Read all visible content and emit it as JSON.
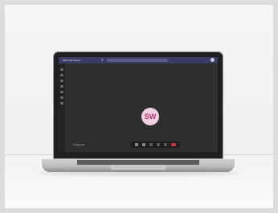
{
  "window": {
    "title": "Microsoft Teams"
  },
  "call": {
    "participant_initials": "SW",
    "selfview_label": "Contoso Ltd."
  },
  "colors": {
    "titlebar": "#3b3b63",
    "avatar_bg": "#f1cfe1",
    "avatar_text": "#b7366f",
    "leave_button": "#c4314b"
  },
  "icons": {
    "rail": [
      "activity-icon",
      "chat-icon",
      "teams-icon",
      "calendar-icon",
      "calls-icon",
      "files-icon",
      "apps-icon"
    ],
    "controls": [
      "camera-icon",
      "mic-icon",
      "share-icon",
      "more-icon",
      "reactions-icon",
      "leave-call-icon"
    ]
  }
}
